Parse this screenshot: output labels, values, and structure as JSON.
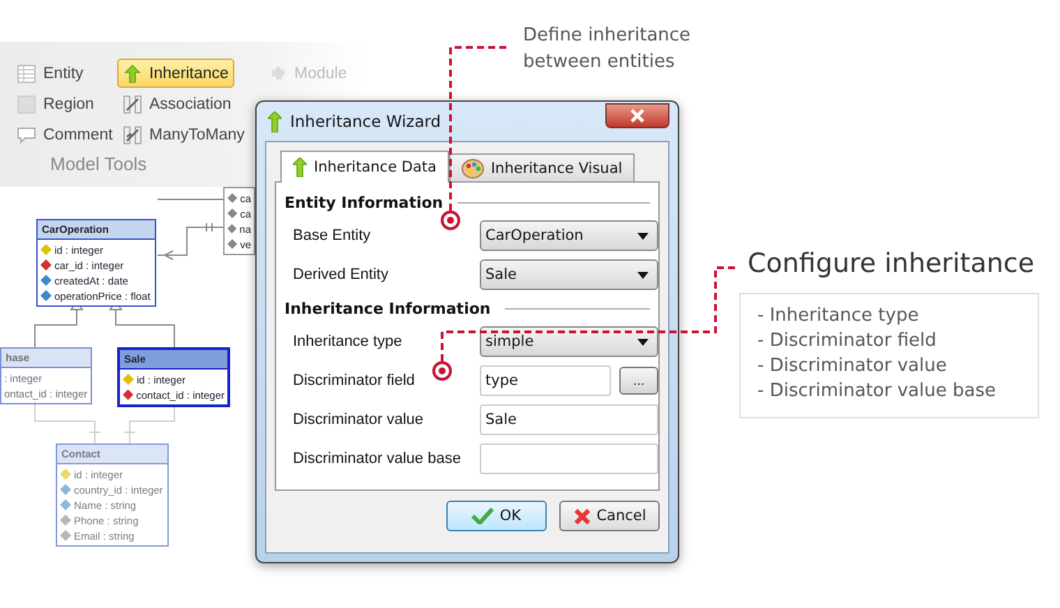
{
  "ribbon": {
    "items": [
      {
        "label": "Entity",
        "kind": "entity",
        "selected": false,
        "disabled": false
      },
      {
        "label": "Region",
        "kind": "region",
        "selected": false,
        "disabled": false
      },
      {
        "label": "Comment",
        "kind": "comment",
        "selected": false,
        "disabled": false
      },
      {
        "label": "Inheritance",
        "kind": "inheritance",
        "selected": true,
        "disabled": false
      },
      {
        "label": "Association",
        "kind": "association",
        "selected": false,
        "disabled": false
      },
      {
        "label": "ManyToMany",
        "kind": "manytomany",
        "selected": false,
        "disabled": false
      },
      {
        "label": "Module",
        "kind": "module",
        "selected": false,
        "disabled": true
      }
    ],
    "group_label": "Model Tools"
  },
  "diagram": {
    "entities": [
      {
        "attributes": [
          {
            "text": "ca",
            "kind": "plain"
          },
          {
            "text": "ca",
            "kind": "plain"
          },
          {
            "text": "na",
            "kind": "plain"
          },
          {
            "text": "ve",
            "kind": "plain"
          }
        ],
        "selected": false
      },
      {
        "name": "CarOperation",
        "selected": false,
        "attributes": [
          {
            "text": "id : integer",
            "kind": "key"
          },
          {
            "text": "car_id : integer",
            "kind": "foreign"
          },
          {
            "text": "createdAt : date",
            "kind": "field"
          },
          {
            "text": "operationPrice : float",
            "kind": "field"
          }
        ]
      },
      {
        "name": "hase",
        "selected": false,
        "attributes": [
          {
            "text": ": integer",
            "kind": "none"
          },
          {
            "text": "ontact_id : integer",
            "kind": "none"
          }
        ]
      },
      {
        "name": "Sale",
        "selected": true,
        "attributes": [
          {
            "text": "id : integer",
            "kind": "key"
          },
          {
            "text": "contact_id : integer",
            "kind": "foreign"
          }
        ]
      },
      {
        "name": "Contact",
        "selected": false,
        "attributes": [
          {
            "text": "id : integer",
            "kind": "key"
          },
          {
            "text": "country_id : integer",
            "kind": "field"
          },
          {
            "text": "Name : string",
            "kind": "field"
          },
          {
            "text": "Phone : string",
            "kind": "plain"
          },
          {
            "text": "Email : string",
            "kind": "plain"
          }
        ]
      }
    ]
  },
  "dialog": {
    "title": "Inheritance Wizard",
    "tabs": [
      {
        "label": "Inheritance Data",
        "kind": "arrow",
        "selected": true
      },
      {
        "label": "Inheritance Visual",
        "kind": "palette",
        "selected": false
      }
    ],
    "sections": [
      {
        "title": "Entity Information",
        "rows": [
          {
            "label": "Base Entity",
            "kind": "select",
            "value": "CarOperation"
          },
          {
            "label": "Derived Entity",
            "kind": "select",
            "value": "Sale"
          }
        ]
      },
      {
        "title": "Inheritance Information",
        "rows": [
          {
            "label": "Inheritance type",
            "kind": "select",
            "value": "simple"
          },
          {
            "label": "Discriminator field",
            "kind": "text_button",
            "value": "type",
            "button": "..."
          },
          {
            "label": "Discriminator value",
            "kind": "text",
            "value": "Sale"
          },
          {
            "label": "Discriminator value base",
            "kind": "text"
          }
        ]
      }
    ],
    "buttons": [
      {
        "label": "OK",
        "kind": "ok"
      },
      {
        "label": "Cancel",
        "kind": "cancel"
      }
    ]
  },
  "callouts": [
    {
      "text": "Define inheritance between entities"
    },
    {
      "title": "Configure inheritance",
      "items": [
        "- Inheritance type",
        "- Discriminator field",
        "- Discriminator value",
        "- Discriminator value base"
      ]
    }
  ]
}
